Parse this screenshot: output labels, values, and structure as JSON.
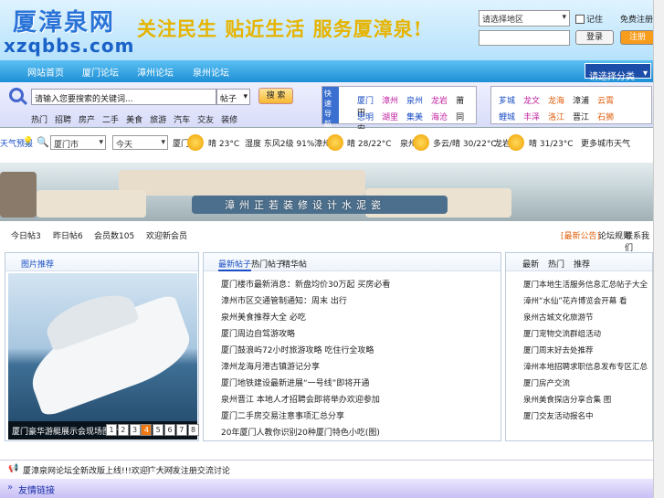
{
  "header": {
    "logo_cn": "厦漳泉网",
    "logo_en": "xzqbbs.com",
    "slogan": "关注民生 贴近生活 服务厦漳泉!",
    "region_select": "请选择地区",
    "remember_label": "记住",
    "register_link": "免费注册",
    "username_placeholder": "",
    "login_button": "登录",
    "signup_button": "注册"
  },
  "nav": {
    "items": [
      "网站首页",
      "厦门论坛",
      "漳州论坛",
      "泉州论坛"
    ],
    "select": "请选择分类"
  },
  "search": {
    "placeholder": "请输入您要搜索的关键词...",
    "type": "帖子",
    "button": "搜 索",
    "hot": [
      "热门",
      "招聘",
      "房产",
      "二手",
      "美食",
      "旅游",
      "汽车",
      "交友",
      "装修"
    ],
    "quick_tab": "快速导航",
    "quick_row1": [
      "厦门",
      "漳州",
      "泉州",
      "龙岩",
      "莆田"
    ],
    "quick_row2": [
      "思明",
      "湖里",
      "集美",
      "海沧",
      "同安"
    ],
    "quick2_row1": [
      "芗城",
      "龙文",
      "龙海",
      "漳浦",
      "云霄"
    ],
    "quick2_row2": [
      "鲤城",
      "丰泽",
      "洛江",
      "晋江",
      "石狮"
    ]
  },
  "weather": {
    "label": "天气预报",
    "city1": "厦门市",
    "city2": "今天",
    "w1": "厦门",
    "w1_temp": "晴 23°C",
    "w1_extra": "湿度 东风2级 91%",
    "w2": "漳州",
    "w2_temp": "晴 28/22°C",
    "w3": "泉州",
    "w3_temp": "多云/晴 30/22°C",
    "w4": "龙岩",
    "w4_temp": "晴 31/23°C",
    "more": "更多城市天气"
  },
  "banner": {
    "text": "漳州正若装修设计水泥瓷"
  },
  "stats": {
    "s1": "今日帖3",
    "s2": "昨日帖6",
    "s3": "会员数105",
    "s4": "欢迎新会员",
    "r1": "[最新公告]",
    "r2": "论坛规则",
    "r3": "联系我们"
  },
  "left_box": {
    "title": "图片推荐",
    "caption": "厦门豪华游艇展示会现场图片9",
    "pages": [
      "1",
      "2",
      "3",
      "4",
      "5",
      "6",
      "7",
      "8"
    ],
    "active_page": 4
  },
  "mid_box": {
    "tabs": [
      "最新帖子",
      "热门帖子",
      "精华帖"
    ],
    "items": [
      "厦门楼市最新消息：新盘均价30万起 买房必看",
      "漳州市区交通管制通知：周末 出行",
      "泉州美食推荐大全 必吃",
      "厦门周边自驾游攻略",
      "厦门鼓浪屿72小时旅游攻略 吃住行全攻略",
      "漳州龙海月港古镇游记分享",
      "厦门地铁建设最新进展“一号线”即将开通",
      "泉州晋江 本地人才招聘会即将举办欢迎参加",
      "厦门二手房交易注意事项汇总分享",
      "20年厦门人教你识别20种厦门特色小吃(图)"
    ]
  },
  "right_box": {
    "tabs": [
      "最新",
      "热门",
      "推荐"
    ],
    "items": [
      "厦门本地生活服务信息汇总帖子大全",
      "漳州“水仙”花卉博览会开幕 看",
      "泉州古城文化旅游节",
      "厦门宠物交流群组活动",
      "厦门周末好去处推荐",
      "漳州本地招聘求职信息发布专区汇总",
      "厦门房产交流",
      "泉州美食探店分享合集 图",
      "厦门交友活动报名中"
    ]
  },
  "notice": {
    "text": "厦漳泉网论坛全新改版上线!!!欢迎广大网友注册交流讨论",
    "date": "11-01-13"
  },
  "footer": {
    "label": "友情链接"
  }
}
